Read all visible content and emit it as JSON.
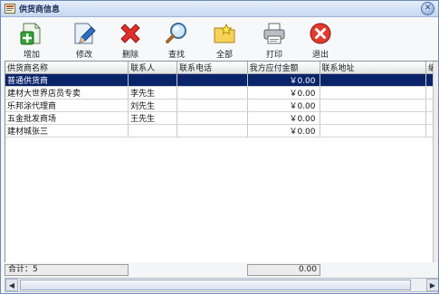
{
  "window": {
    "title": "供货商信息",
    "close_symbol": "✕"
  },
  "toolbar": {
    "buttons": [
      {
        "label": "增加",
        "icon": "add-document-icon"
      },
      {
        "label": "修改",
        "icon": "edit-document-icon"
      },
      {
        "label": "删除",
        "icon": "delete-x-icon"
      },
      {
        "label": "查找",
        "icon": "magnifier-icon"
      },
      {
        "label": "全部",
        "icon": "folder-star-icon"
      },
      {
        "label": "打印",
        "icon": "printer-icon"
      },
      {
        "label": "退出",
        "icon": "exit-icon"
      }
    ]
  },
  "table": {
    "columns": [
      "供货商名称",
      "联系人",
      "联系电话",
      "我方应付金额",
      "联系地址",
      "编"
    ],
    "rows": [
      {
        "name": "普通供货商",
        "contact": "",
        "phone": "",
        "amount": "￥0.00",
        "address": "",
        "selected": true
      },
      {
        "name": "建材大世界店员专卖",
        "contact": "李先生",
        "phone": "",
        "amount": "￥0.00",
        "address": "",
        "selected": false
      },
      {
        "name": "乐邦涂代理商",
        "contact": "刘先生",
        "phone": "",
        "amount": "￥0.00",
        "address": "",
        "selected": false
      },
      {
        "name": "五金批发商场",
        "contact": "王先生",
        "phone": "",
        "amount": "￥0.00",
        "address": "",
        "selected": false
      },
      {
        "name": "建材城张三",
        "contact": "",
        "phone": "",
        "amount": "￥0.00",
        "address": "",
        "selected": false
      }
    ]
  },
  "footer": {
    "total_label": "合计：5",
    "total_amount": "0.00"
  },
  "colors": {
    "selection": "#0a246a",
    "title_bar": "#c7d7ef"
  }
}
